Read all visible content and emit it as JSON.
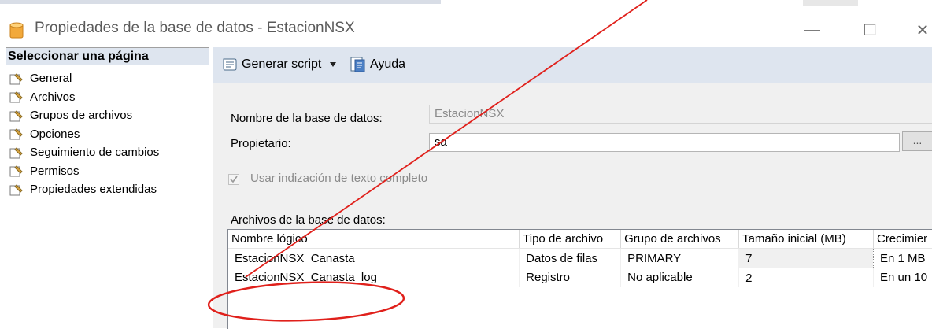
{
  "window": {
    "title": "Propiedades de la base de datos - EstacionNSX",
    "minimize_glyph": "—",
    "maximize_glyph": "☐",
    "close_glyph": "✕"
  },
  "left_pane": {
    "header": "Seleccionar una página",
    "items": [
      {
        "label": "General"
      },
      {
        "label": "Archivos"
      },
      {
        "label": "Grupos de archivos"
      },
      {
        "label": "Opciones"
      },
      {
        "label": "Seguimiento de cambios"
      },
      {
        "label": "Permisos"
      },
      {
        "label": "Propiedades extendidas"
      }
    ]
  },
  "toolbar": {
    "script_label": "Generar script",
    "help_label": "Ayuda"
  },
  "form": {
    "db_name_label": "Nombre de la base de datos:",
    "db_name_value": "EstacionNSX",
    "owner_label": "Propietario:",
    "owner_value": "sa",
    "browse_label": "...",
    "fulltext_label": "Usar indización de texto completo",
    "fulltext_checked": true
  },
  "files": {
    "section_label": "Archivos de la base de datos:",
    "columns": [
      "Nombre lógico",
      "Tipo de archivo",
      "Grupo de archivos",
      "Tamaño inicial (MB)",
      "Crecimier"
    ],
    "rows": [
      [
        "EstacionNSX_Canasta",
        "Datos de filas",
        "PRIMARY",
        "7",
        "En 1 MB"
      ],
      [
        "EstacionNSX_Canasta_log",
        "Registro",
        "No aplicable",
        "2",
        "En un 10"
      ]
    ]
  },
  "colors": {
    "pane_header": "#dee5ef",
    "annotation_red": "#e0201b"
  }
}
